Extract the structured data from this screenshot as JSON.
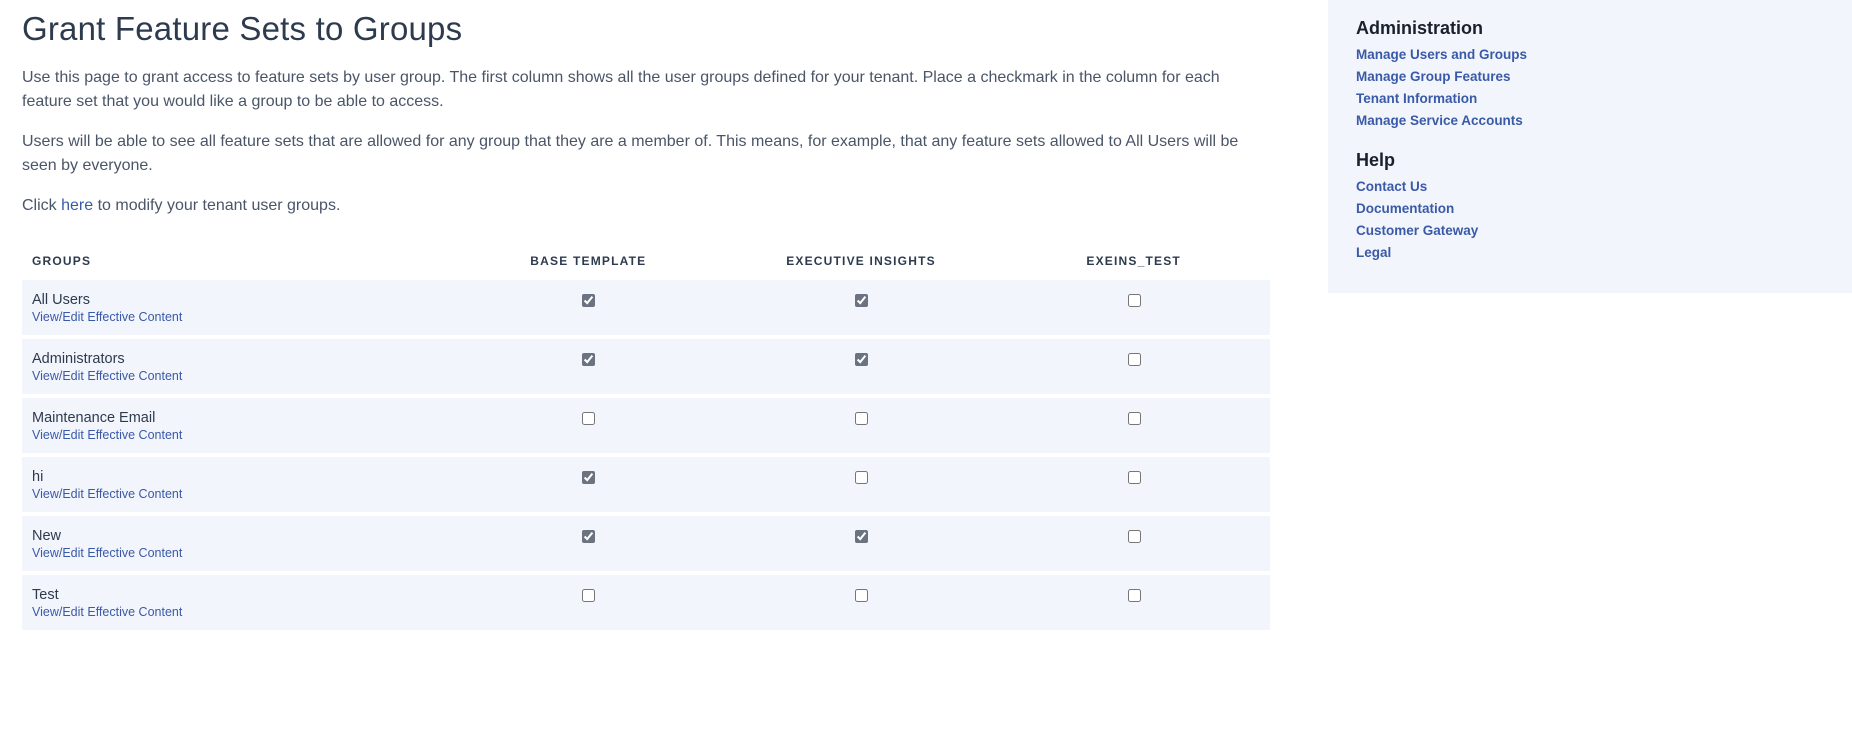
{
  "page": {
    "title": "Grant Feature Sets to Groups",
    "desc1": "Use this page to grant access to feature sets by user group. The first column shows all the user groups defined for your tenant. Place a checkmark in the column for each feature set that you would like a group to be able to access.",
    "desc2": "Users will be able to see all feature sets that are allowed for any group that they are a member of. This means, for example, that any feature sets allowed to All Users will be seen by everyone.",
    "desc3_prefix": "Click ",
    "desc3_link": "here",
    "desc3_suffix": " to modify your tenant user groups."
  },
  "table": {
    "header_groups": "GROUPS",
    "feature_sets": [
      {
        "label": "BASE TEMPLATE"
      },
      {
        "label": "EXECUTIVE INSIGHTS"
      },
      {
        "label": "EXEINS_TEST"
      }
    ],
    "view_edit_label": "View/Edit Effective Content",
    "rows": [
      {
        "name": "All Users",
        "checks": [
          true,
          true,
          false
        ]
      },
      {
        "name": "Administrators",
        "checks": [
          true,
          true,
          false
        ]
      },
      {
        "name": "Maintenance Email",
        "checks": [
          false,
          false,
          false
        ]
      },
      {
        "name": "hi",
        "checks": [
          true,
          false,
          false
        ]
      },
      {
        "name": "New",
        "checks": [
          true,
          true,
          false
        ]
      },
      {
        "name": "Test",
        "checks": [
          false,
          false,
          false
        ]
      }
    ]
  },
  "sidebar": {
    "admin_heading": "Administration",
    "admin_links": [
      "Manage Users and Groups",
      "Manage Group Features",
      "Tenant Information",
      "Manage Service Accounts"
    ],
    "help_heading": "Help",
    "help_links": [
      "Contact Us",
      "Documentation",
      "Customer Gateway",
      "Legal"
    ]
  }
}
